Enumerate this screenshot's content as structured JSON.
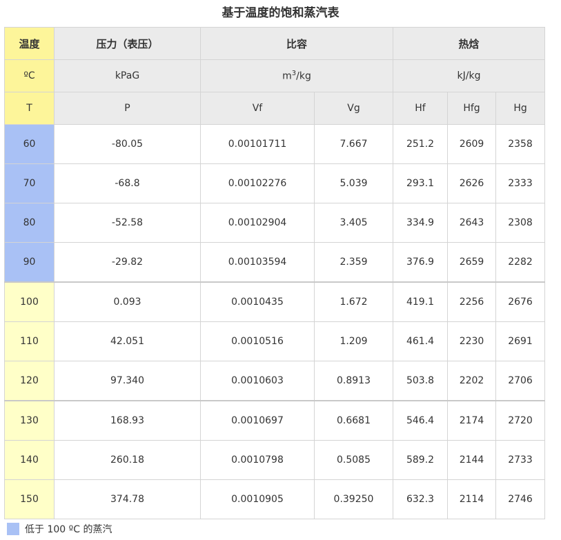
{
  "title": "基于温度的饱和蒸汽表",
  "colors": {
    "low_temp": "#a9c1f5",
    "high_temp": "#ffffc8",
    "temp_header": "#fdf59a",
    "header_bg": "#ebebeb"
  },
  "headers": {
    "temp": "温度",
    "pressure": "压力（表压）",
    "volume": "比容",
    "enthalpy": "热焓"
  },
  "units": {
    "temp": "ºC",
    "pressure": "kPaG",
    "volume_base": "m",
    "volume_exp": "3",
    "volume_rest": "/kg",
    "enthalpy": "kJ/kg"
  },
  "symbols": {
    "T": "T",
    "P": "P",
    "Vf": "Vf",
    "Vg": "Vg",
    "Hf": "Hf",
    "Hfg": "Hfg",
    "Hg": "Hg"
  },
  "rows": [
    {
      "T": "60",
      "P": "-80.05",
      "Vf": "0.00101711",
      "Vg": "7.667",
      "Hf": "251.2",
      "Hfg": "2609",
      "Hg": "2358"
    },
    {
      "T": "70",
      "P": "-68.8",
      "Vf": "0.00102276",
      "Vg": "5.039",
      "Hf": "293.1",
      "Hfg": "2626",
      "Hg": "2333"
    },
    {
      "T": "80",
      "P": "-52.58",
      "Vf": "0.00102904",
      "Vg": "3.405",
      "Hf": "334.9",
      "Hfg": "2643",
      "Hg": "2308"
    },
    {
      "T": "90",
      "P": "-29.82",
      "Vf": "0.00103594",
      "Vg": "2.359",
      "Hf": "376.9",
      "Hfg": "2659",
      "Hg": "2282"
    },
    {
      "T": "100",
      "P": "0.093",
      "Vf": "0.0010435",
      "Vg": "1.672",
      "Hf": "419.1",
      "Hfg": "2256",
      "Hg": "2676"
    },
    {
      "T": "110",
      "P": "42.051",
      "Vf": "0.0010516",
      "Vg": "1.209",
      "Hf": "461.4",
      "Hfg": "2230",
      "Hg": "2691"
    },
    {
      "T": "120",
      "P": "97.340",
      "Vf": "0.0010603",
      "Vg": "0.8913",
      "Hf": "503.8",
      "Hfg": "2202",
      "Hg": "2706"
    },
    {
      "T": "130",
      "P": "168.93",
      "Vf": "0.0010697",
      "Vg": "0.6681",
      "Hf": "546.4",
      "Hfg": "2174",
      "Hg": "2720"
    },
    {
      "T": "140",
      "P": "260.18",
      "Vf": "0.0010798",
      "Vg": "0.5085",
      "Hf": "589.2",
      "Hfg": "2144",
      "Hg": "2733"
    },
    {
      "T": "150",
      "P": "374.78",
      "Vf": "0.0010905",
      "Vg": "0.39250",
      "Hf": "632.3",
      "Hfg": "2114",
      "Hg": "2746"
    }
  ],
  "legend": {
    "label": "低于 100 ºC 的蒸汽"
  }
}
